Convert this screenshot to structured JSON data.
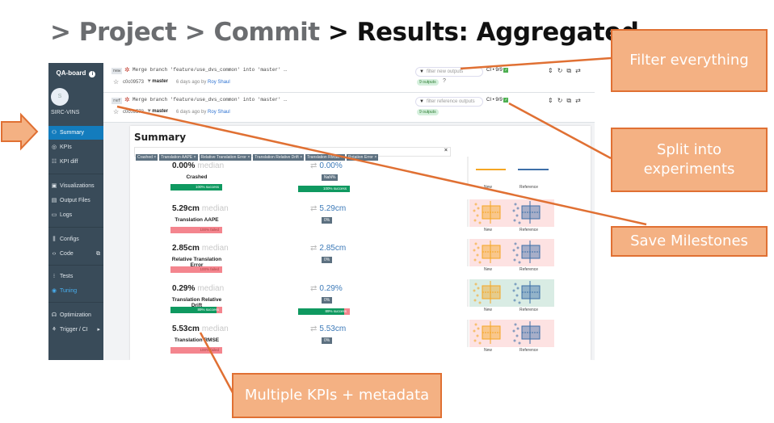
{
  "heading": {
    "crumb1": "> Project",
    "crumb2": " > Commit",
    "current": " > Results: Aggregated"
  },
  "sidebar": {
    "title": "QA-board",
    "info_icon": "i",
    "avatar_letter": "S",
    "user": "SIRC-VINS",
    "items": [
      {
        "label": "Summary",
        "icon": "⚇"
      },
      {
        "label": "KPIs",
        "icon": "◎"
      },
      {
        "label": "KPI diff",
        "icon": "☷"
      },
      {
        "label": "Visualizations",
        "icon": "▣"
      },
      {
        "label": "Output Files",
        "icon": "▤"
      },
      {
        "label": "Logs",
        "icon": "▭"
      },
      {
        "label": "Configs",
        "icon": "⫼"
      },
      {
        "label": "Code",
        "icon": "‹›",
        "extra": "⧉"
      },
      {
        "label": "Tests",
        "icon": "⁝"
      },
      {
        "label": "Tuning",
        "icon": "◉"
      },
      {
        "label": "Optimization",
        "icon": "☊"
      },
      {
        "label": "Trigger / CI",
        "icon": "⚘",
        "extra": "▸"
      }
    ]
  },
  "experiments": [
    {
      "tag": "new",
      "message": "Merge branch 'feature/use_dvs_common' into 'master' …",
      "hash": "c0c09573",
      "branch": "master",
      "time": "6 days ago by",
      "author": "Roy Shaul",
      "filter_placeholder": "filter new outputs",
      "ci": "CI • 9/9",
      "outputs": "9 outputs",
      "help": "?"
    },
    {
      "tag": "ref",
      "message": "Merge branch 'feature/use_dvs_common' into 'master' …",
      "hash": "c0c09573",
      "branch": "master",
      "time": "6 days ago by",
      "author": "Roy Shaul",
      "filter_placeholder": "filter reference outputs",
      "ci": "CI • 9/9",
      "outputs": "9 outputs"
    }
  ],
  "summary": {
    "title": "Summary",
    "tags": [
      "Crashed ×",
      "Translation AAPE ×",
      "Relative Translation Error ×",
      "Translation Relative Drift ×",
      "Translation RMSE ×",
      "Rotation Error ×"
    ],
    "clear": "×",
    "median_label": "median",
    "kpis": [
      {
        "value": "0.00%",
        "name": "Crashed",
        "bar": "100% success",
        "bar_status": "success",
        "success_fraction": 1.0,
        "ref_value": "0.00%",
        "ref_badge": "NaN%",
        "ref_bar": "100% success",
        "ref_success_fraction": 1.0
      },
      {
        "value": "5.29cm",
        "name": "Translation AAPE",
        "bar": "100% failed",
        "bar_status": "failed",
        "success_fraction": 0.0,
        "ref_value": "5.29cm",
        "ref_badge": "0%"
      },
      {
        "value": "2.85cm",
        "name": "Relative Translation Error",
        "bar": "100% failed",
        "bar_status": "failed",
        "success_fraction": 0.0,
        "ref_value": "2.85cm",
        "ref_badge": "0%"
      },
      {
        "value": "0.29%",
        "name": "Translation Relative Drift",
        "bar": "89% success",
        "bar_status": "mixed",
        "success_fraction": 0.89,
        "ref_value": "0.29%",
        "ref_badge": "0%",
        "ref_bar": "89% success",
        "ref_success_fraction": 0.89
      },
      {
        "value": "5.53cm",
        "name": "Translation RMSE",
        "bar": "100% failed",
        "bar_status": "failed",
        "success_fraction": 0.0,
        "ref_value": "5.53cm",
        "ref_badge": "0%"
      }
    ],
    "plot_labels": {
      "new": "New",
      "reference": "Reference"
    },
    "colors": {
      "success": "#0f9960",
      "failed": "#f4858e",
      "new": "#f5a623",
      "reference": "#3d6fa8",
      "bg_fail": "#fde2e2",
      "bg_ok": "#d9ece4"
    }
  },
  "annotations": {
    "filter": "Filter everything",
    "split": "Split into experiments",
    "milestones": "Save Milestones",
    "kpis": "Multiple KPIs + metadata"
  }
}
